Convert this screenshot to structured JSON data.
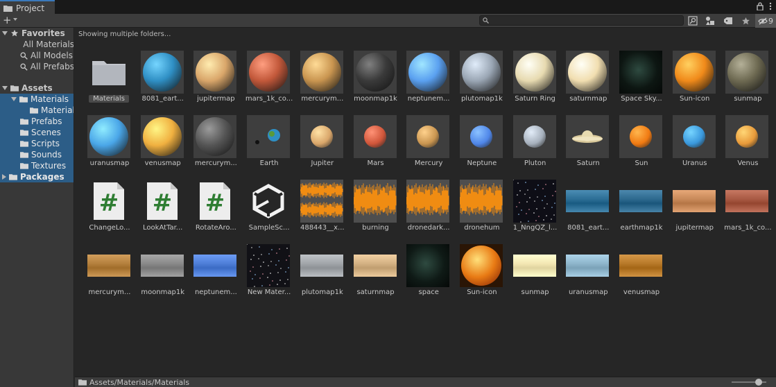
{
  "window": {
    "tab_title": "Project"
  },
  "toolbar": {
    "search_value": "",
    "hidden_count": "9"
  },
  "sidebar": {
    "favorites": {
      "label": "Favorites",
      "items": [
        "All Materials",
        "All Models",
        "All Prefabs"
      ]
    },
    "assets": {
      "label": "Assets",
      "items": [
        "Materials",
        "Material",
        "Prefabs",
        "Scenes",
        "Scripts",
        "Sounds",
        "Textures"
      ]
    },
    "packages": {
      "label": "Packages"
    }
  },
  "main": {
    "info": "Showing multiple folders..."
  },
  "assets": [
    {
      "label": "Materials",
      "kind": "folder"
    },
    {
      "label": "8081_eart...",
      "kind": "sphere",
      "color": "#2f8fc4"
    },
    {
      "label": "jupitermap",
      "kind": "sphere",
      "color": "#d9a66a"
    },
    {
      "label": "mars_1k_co...",
      "kind": "sphere",
      "color": "#c2583a"
    },
    {
      "label": "mercurym...",
      "kind": "sphere",
      "color": "#c99550"
    },
    {
      "label": "moonmap1k",
      "kind": "sphere",
      "color": "#3a3a3a"
    },
    {
      "label": "neptunem...",
      "kind": "sphere",
      "color": "#5aa0f0"
    },
    {
      "label": "plutomap1k",
      "kind": "sphere",
      "color": "#9aa6b4"
    },
    {
      "label": "Saturn Ring",
      "kind": "sphere",
      "color": "#e7dab0"
    },
    {
      "label": "saturnmap",
      "kind": "sphere",
      "color": "#f1deb0"
    },
    {
      "label": "Space Sky...",
      "kind": "space",
      "color": "#0d1612"
    },
    {
      "label": "Sun-icon",
      "kind": "sphere",
      "color": "#f08a1a"
    },
    {
      "label": "sunmap",
      "kind": "sphere",
      "color": "#6e6a52"
    },
    {
      "label": "uranusmap",
      "kind": "sphere",
      "color": "#4aa6e8"
    },
    {
      "label": "venusmap",
      "kind": "sphere",
      "color": "#f0b040"
    },
    {
      "label": "mercurym...",
      "kind": "sphere",
      "color": "#555555"
    },
    {
      "label": "Earth",
      "kind": "earth",
      "color": "#2f8fc4"
    },
    {
      "label": "Jupiter",
      "kind": "small",
      "color": "#d9a66a"
    },
    {
      "label": "Mars",
      "kind": "small",
      "color": "#d0563a"
    },
    {
      "label": "Mercury",
      "kind": "small",
      "color": "#c99550"
    },
    {
      "label": "Neptune",
      "kind": "small",
      "color": "#4f86e8"
    },
    {
      "label": "Pluton",
      "kind": "small",
      "color": "#a6b0bc"
    },
    {
      "label": "Saturn",
      "kind": "saturn",
      "color": "#e7dab0"
    },
    {
      "label": "Sun",
      "kind": "small",
      "color": "#f07a12"
    },
    {
      "label": "Uranus",
      "kind": "small",
      "color": "#3a98dc"
    },
    {
      "label": "Venus",
      "kind": "small",
      "color": "#e89a3a"
    },
    {
      "label": "ChangeLo...",
      "kind": "script"
    },
    {
      "label": "LookAtTar...",
      "kind": "script"
    },
    {
      "label": "RotateAro...",
      "kind": "script"
    },
    {
      "label": "SampleSc...",
      "kind": "unity"
    },
    {
      "label": "488443__x...",
      "kind": "audio2"
    },
    {
      "label": "burning",
      "kind": "audio"
    },
    {
      "label": "dronedark...",
      "kind": "audio"
    },
    {
      "label": "dronehum",
      "kind": "audio"
    },
    {
      "label": "1_NngQZ_l...",
      "kind": "stars",
      "color": "#0e0e16"
    },
    {
      "label": "8081_eart...",
      "kind": "tex",
      "color": "#2d6f96"
    },
    {
      "label": "earthmap1k",
      "kind": "tex",
      "color": "#2e6a8f"
    },
    {
      "label": "jupitermap",
      "kind": "tex",
      "color": "#c98a5a"
    },
    {
      "label": "mars_1k_co...",
      "kind": "tex",
      "color": "#a95a44"
    },
    {
      "label": "mercurym...",
      "kind": "tex",
      "color": "#b5813e"
    },
    {
      "label": "moonmap1k",
      "kind": "tex",
      "color": "#8a8a8a"
    },
    {
      "label": "neptunem...",
      "kind": "tex",
      "color": "#4f7fd8"
    },
    {
      "label": "New Mater...",
      "kind": "stars",
      "color": "#111116"
    },
    {
      "label": "plutomap1k",
      "kind": "tex",
      "color": "#a2a6aa"
    },
    {
      "label": "saturnmap",
      "kind": "tex",
      "color": "#d4b284"
    },
    {
      "label": "space",
      "kind": "space",
      "color": "#0f1a16"
    },
    {
      "label": "Sun-icon",
      "kind": "sunicon",
      "color": "#e87a14"
    },
    {
      "label": "sunmap",
      "kind": "tex",
      "color": "#f4e8b4"
    },
    {
      "label": "uranusmap",
      "kind": "tex",
      "color": "#8fb6cc"
    },
    {
      "label": "venusmap",
      "kind": "tex",
      "color": "#b87a2a"
    }
  ],
  "footer": {
    "path": "Assets/Materials/Materials"
  }
}
